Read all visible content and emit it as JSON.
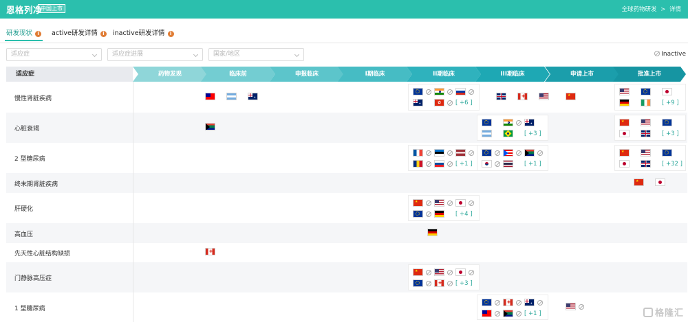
{
  "topbar": {
    "title": "恩格列净",
    "badge": "中国上市",
    "breadcrumb": [
      "全球药物研发",
      ">",
      "详情"
    ]
  },
  "tabs": [
    {
      "label": "研发现状",
      "active": true
    },
    {
      "label": "active研发详情",
      "active": false
    },
    {
      "label": "inactive研发详情",
      "active": false
    }
  ],
  "filters": {
    "indication_placeholder": "适应症",
    "status_placeholder": "适应症进展",
    "region_placeholder": "国家/地区",
    "inactive_legend": "Inactive"
  },
  "table": {
    "indication_header": "适应症",
    "phases": [
      {
        "label": "药物发现",
        "color": "#8fd6d9"
      },
      {
        "label": "临床前",
        "color": "#73cdd2"
      },
      {
        "label": "申报临床",
        "color": "#5cc5cb"
      },
      {
        "label": "I期临床",
        "color": "#46bcc4"
      },
      {
        "label": "II期临床",
        "color": "#2fb2bd"
      },
      {
        "label": "III期临床",
        "color": "#1ea8b4"
      },
      {
        "label": "申请上市",
        "color": "#1b9eab"
      },
      {
        "label": "批准上市",
        "color": "#1695a2"
      }
    ],
    "rows": [
      {
        "indication": "慢性肾脏疾病",
        "cells": [
          {
            "phase": 1,
            "flags": [
              [
                "tw",
                false
              ],
              [
                "ar",
                false
              ],
              [
                "au",
                false
              ]
            ],
            "more": ""
          },
          {
            "phase": 4,
            "flags": [
              [
                "eu",
                true
              ],
              [
                "in",
                true
              ],
              [
                "ru",
                true
              ],
              [
                "au",
                false
              ],
              [
                "hk",
                true
              ]
            ],
            "more": "[ +6 ]"
          },
          {
            "phase": 5,
            "flags": [
              [
                "gb",
                false
              ],
              [
                "ca",
                false
              ],
              [
                "us",
                false
              ]
            ],
            "more": ""
          },
          {
            "phase": 6,
            "flags": [
              [
                "cn",
                false
              ]
            ],
            "more": ""
          },
          {
            "phase": 7,
            "flags": [
              [
                "us",
                false
              ],
              [
                "eu",
                false
              ],
              [
                "jp",
                false
              ],
              [
                "de",
                false
              ],
              [
                "ie",
                false
              ]
            ],
            "more": "[ +9 ]"
          }
        ]
      },
      {
        "indication": "心脏衰竭",
        "cells": [
          {
            "phase": 1,
            "flags": [
              [
                "za",
                false
              ]
            ],
            "more": ""
          },
          {
            "phase": 5,
            "flags": [
              [
                "eu",
                false
              ],
              [
                "in",
                true
              ],
              [
                "au",
                false
              ],
              [
                "ar",
                false
              ],
              [
                "br",
                false
              ]
            ],
            "more": "[ +3 ]"
          },
          {
            "phase": 7,
            "flags": [
              [
                "cn",
                false
              ],
              [
                "us",
                false
              ],
              [
                "eu",
                false
              ],
              [
                "jp",
                false
              ],
              [
                "gb",
                false
              ]
            ],
            "more": "[ +3 ]"
          }
        ]
      },
      {
        "indication": "2 型糖尿病",
        "cells": [
          {
            "phase": 4,
            "flags": [
              [
                "fr",
                true
              ],
              [
                "ee",
                true
              ],
              [
                "lv",
                true
              ],
              [
                "ro",
                true
              ],
              [
                "sk",
                true
              ]
            ],
            "more": "[ +1 ]"
          },
          {
            "phase": 5,
            "flags": [
              [
                "eu",
                true
              ],
              [
                "pr",
                true
              ],
              [
                "za",
                true
              ],
              [
                "kr",
                true
              ],
              [
                "th",
                false
              ]
            ],
            "more": "[ +1 ]"
          },
          {
            "phase": 7,
            "flags": [
              [
                "cn",
                false
              ],
              [
                "us",
                false
              ],
              [
                "eu",
                false
              ],
              [
                "jp",
                false
              ],
              [
                "gb",
                false
              ]
            ],
            "more": "[ +32 ]"
          }
        ]
      },
      {
        "indication": "终末期肾脏疾病",
        "cells": [
          {
            "phase": 7,
            "flags": [
              [
                "cn",
                false
              ],
              [
                "jp",
                false
              ]
            ],
            "more": ""
          }
        ]
      },
      {
        "indication": "肝硬化",
        "cells": [
          {
            "phase": 4,
            "flags": [
              [
                "cn",
                true
              ],
              [
                "us",
                true
              ],
              [
                "jp",
                true
              ],
              [
                "eu",
                true
              ],
              [
                "de",
                false
              ]
            ],
            "more": "[ +4 ]"
          }
        ]
      },
      {
        "indication": "高血压",
        "cells": [
          {
            "phase": 4,
            "flags": [
              [
                "de",
                false
              ]
            ],
            "more": ""
          }
        ]
      },
      {
        "indication": "先天性心脏结构缺损",
        "cells": [
          {
            "phase": 1,
            "flags": [
              [
                "ca",
                false
              ]
            ],
            "more": ""
          }
        ]
      },
      {
        "indication": "门静脉高压症",
        "cells": [
          {
            "phase": 4,
            "flags": [
              [
                "cn",
                true
              ],
              [
                "us",
                true
              ],
              [
                "jp",
                true
              ],
              [
                "eu",
                true
              ],
              [
                "ca",
                true
              ]
            ],
            "more": "[ +3 ]"
          }
        ]
      },
      {
        "indication": "1 型糖尿病",
        "cells": [
          {
            "phase": 5,
            "flags": [
              [
                "eu",
                true
              ],
              [
                "ca",
                true
              ],
              [
                "au",
                true
              ],
              [
                "tw",
                true
              ],
              [
                "za",
                true
              ]
            ],
            "more": "[ +1 ]"
          },
          {
            "phase": 6,
            "flags": [
              [
                "us",
                true
              ]
            ],
            "more": ""
          }
        ]
      }
    ]
  },
  "watermark": "格隆汇"
}
